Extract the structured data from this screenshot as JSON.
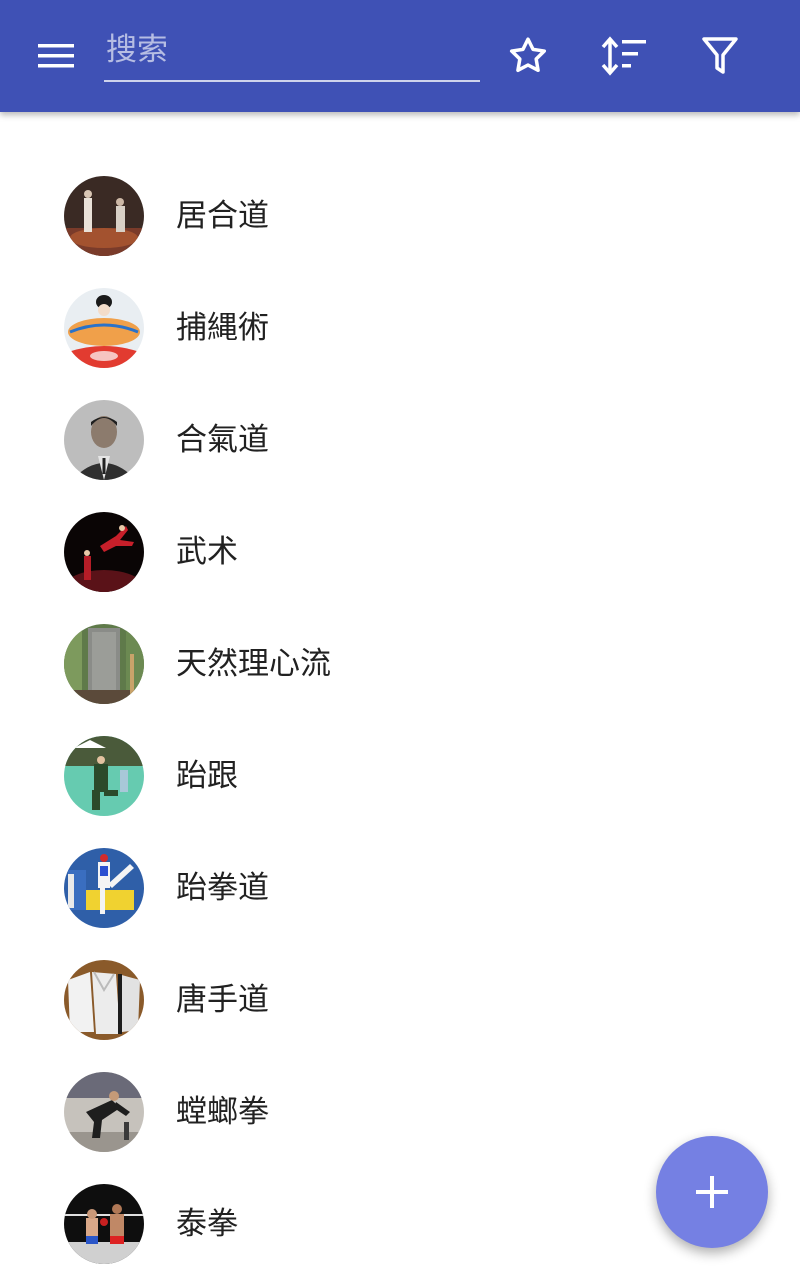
{
  "toolbar": {
    "menu_icon": "menu-icon",
    "search_placeholder": "搜索",
    "search_value": "",
    "actions": [
      "star-icon",
      "sort-icon",
      "filter-icon"
    ],
    "color": "#3f51b5"
  },
  "items": [
    {
      "label": "居合道",
      "icon": "iaido-photo"
    },
    {
      "label": "捕縄術",
      "icon": "hojojutsu-illustration"
    },
    {
      "label": "合氣道",
      "icon": "aikido-portrait"
    },
    {
      "label": "武术",
      "icon": "wushu-photo"
    },
    {
      "label": "天然理心流",
      "icon": "stone-monument-photo"
    },
    {
      "label": "跆跟",
      "icon": "taekkyon-photo"
    },
    {
      "label": "跆拳道",
      "icon": "taekwondo-photo"
    },
    {
      "label": "唐手道",
      "icon": "karate-uniform-photo"
    },
    {
      "label": "螳螂拳",
      "icon": "mantis-fist-photo"
    },
    {
      "label": "泰拳",
      "icon": "muay-thai-photo"
    }
  ],
  "fab": {
    "icon": "plus-icon",
    "color": "#7580e3"
  }
}
